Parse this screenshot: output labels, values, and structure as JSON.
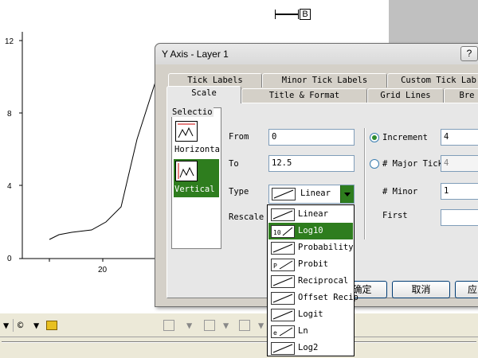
{
  "plot": {
    "y_ticks": [
      "12",
      "8",
      "4",
      "0"
    ],
    "x_ticks": [
      "20"
    ],
    "legend_label": "B"
  },
  "dialog": {
    "title": "Y Axis - Layer 1",
    "help_label": "?",
    "tabs_back": [
      "Tick Labels",
      "Minor Tick Labels",
      "Custom Tick Lab"
    ],
    "tabs_front": [
      "Scale",
      "Title & Format",
      "Grid Lines",
      "Bre"
    ],
    "selection": {
      "label": "Selectio",
      "items": [
        {
          "label": "Horizonta",
          "selected": false
        },
        {
          "label": "Vertical",
          "selected": true
        }
      ]
    },
    "from": {
      "label": "From",
      "value": "0"
    },
    "to": {
      "label": "To",
      "value": "12.5"
    },
    "type": {
      "label": "Type",
      "value": "Linear"
    },
    "rescale": {
      "label": "Rescale"
    },
    "increment": {
      "label": "Increment",
      "value": "4",
      "selected": true
    },
    "major_ticks": {
      "label": "# Major Tick",
      "value": "4",
      "selected": false
    },
    "minor": {
      "label": "# Minor",
      "value": "1"
    },
    "first": {
      "label": "First",
      "value": ""
    },
    "ok_label": "确定",
    "cancel_label": "取消",
    "apply_label": "应"
  },
  "dropdown": {
    "items": [
      {
        "label": "Linear",
        "icon": "linear-scale-icon"
      },
      {
        "label": "Log10",
        "icon": "log10-scale-icon",
        "selected": true
      },
      {
        "label": "Probability",
        "icon": "probability-scale-icon"
      },
      {
        "label": "Probit",
        "icon": "probit-scale-icon"
      },
      {
        "label": "Reciprocal",
        "icon": "reciprocal-scale-icon"
      },
      {
        "label": "Offset Recip",
        "icon": "offset-reciprocal-scale-icon"
      },
      {
        "label": "Logit",
        "icon": "logit-scale-icon"
      },
      {
        "label": "Ln",
        "icon": "ln-scale-icon"
      },
      {
        "label": "Log2",
        "icon": "log2-scale-icon"
      }
    ]
  },
  "toolbar": {
    "copyright_glyph": "©"
  },
  "colors": {
    "selection_green": "#2e7d1e",
    "dialog_bg": "#d4d0c8"
  }
}
